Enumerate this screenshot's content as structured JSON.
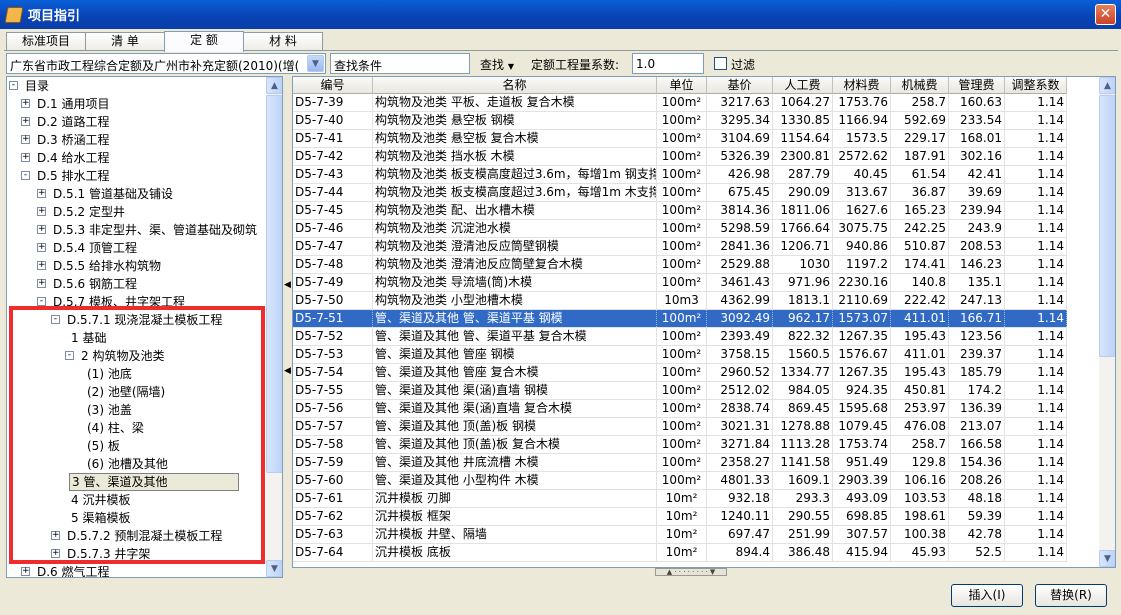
{
  "window": {
    "title": "项目指引"
  },
  "tabs": [
    "标准项目",
    "清 单",
    "定 额",
    "材 料"
  ],
  "toolbar": {
    "library": "广东省市政工程综合定额及广州市补充定额(2010)(增(",
    "search_value": "查找条件",
    "find_label": "查找",
    "coef_label": "定额工程量系数:",
    "coef_value": "1.0",
    "filter_label": "过滤"
  },
  "tree": [
    {
      "label": "目录",
      "pm": "-",
      "lvl": 0
    },
    {
      "label": "D.1  通用项目",
      "pm": "+",
      "lvl": 1
    },
    {
      "label": "D.2  道路工程",
      "pm": "+",
      "lvl": 1
    },
    {
      "label": "D.3  桥涵工程",
      "pm": "+",
      "lvl": 1
    },
    {
      "label": "D.4  给水工程",
      "pm": "+",
      "lvl": 1
    },
    {
      "label": "D.5  排水工程",
      "pm": "-",
      "lvl": 1
    },
    {
      "label": "D.5.1  管道基础及铺设",
      "pm": "+",
      "lvl": 2
    },
    {
      "label": "D.5.2  定型井",
      "pm": "+",
      "lvl": 2
    },
    {
      "label": "D.5.3  非定型井、渠、管道基础及砌筑",
      "pm": "+",
      "lvl": 2
    },
    {
      "label": "D.5.4  顶管工程",
      "pm": "+",
      "lvl": 2
    },
    {
      "label": "D.5.5  给排水构筑物",
      "pm": "+",
      "lvl": 2
    },
    {
      "label": "D.5.6  钢筋工程",
      "pm": "+",
      "lvl": 2
    },
    {
      "label": "D.5.7  模板、井字架工程",
      "pm": "-",
      "lvl": 2
    },
    {
      "label": "D.5.7.1  现浇混凝土模板工程",
      "pm": "-",
      "lvl": 3
    },
    {
      "label": "1  基础",
      "pm": "",
      "lvl": 4
    },
    {
      "label": "2  构筑物及池类",
      "pm": "-",
      "lvl": 4
    },
    {
      "label": "(1)  池底",
      "pm": "",
      "lvl": 5
    },
    {
      "label": "(2)  池壁(隔墙)",
      "pm": "",
      "lvl": 5
    },
    {
      "label": "(3)  池盖",
      "pm": "",
      "lvl": 5
    },
    {
      "label": "(4)  柱、梁",
      "pm": "",
      "lvl": 5
    },
    {
      "label": "(5)  板",
      "pm": "",
      "lvl": 5
    },
    {
      "label": "(6)  池槽及其他",
      "pm": "",
      "lvl": 5
    },
    {
      "label": "3  管、渠道及其他",
      "pm": "",
      "lvl": 4,
      "selected": true
    },
    {
      "label": "4  沉井模板",
      "pm": "",
      "lvl": 4
    },
    {
      "label": "5  渠箱模板",
      "pm": "",
      "lvl": 4
    },
    {
      "label": "D.5.7.2  预制混凝土模板工程",
      "pm": "+",
      "lvl": 3
    },
    {
      "label": "D.5.7.3  井字架",
      "pm": "+",
      "lvl": 3
    },
    {
      "label": "D.6  燃气工程",
      "pm": "+",
      "lvl": 1
    }
  ],
  "grid": {
    "columns": [
      "编号",
      "名称",
      "单位",
      "基价",
      "人工费",
      "材料费",
      "机械费",
      "管理费",
      "调整系数"
    ],
    "selected_index": 12,
    "rows": [
      [
        "D5-7-39",
        "构筑物及池类 平板、走道板 复合木模",
        "100m²",
        "3217.63",
        "1064.27",
        "1753.76",
        "258.7",
        "160.63",
        "1.14"
      ],
      [
        "D5-7-40",
        "构筑物及池类 悬空板 钢模",
        "100m²",
        "3295.34",
        "1330.85",
        "1166.94",
        "592.69",
        "233.54",
        "1.14"
      ],
      [
        "D5-7-41",
        "构筑物及池类 悬空板 复合木模",
        "100m²",
        "3104.69",
        "1154.64",
        "1573.5",
        "229.17",
        "168.01",
        "1.14"
      ],
      [
        "D5-7-42",
        "构筑物及池类 挡水板 木模",
        "100m²",
        "5326.39",
        "2300.81",
        "2572.62",
        "187.91",
        "302.16",
        "1.14"
      ],
      [
        "D5-7-43",
        "构筑物及池类 板支模高度超过3.6m，每增1m 钢支撑",
        "100m²",
        "426.98",
        "287.79",
        "40.45",
        "61.54",
        "42.41",
        "1.14"
      ],
      [
        "D5-7-44",
        "构筑物及池类 板支模高度超过3.6m，每增1m 木支撑",
        "100m²",
        "675.45",
        "290.09",
        "313.67",
        "36.87",
        "39.69",
        "1.14"
      ],
      [
        "D5-7-45",
        "构筑物及池类 配、出水槽木模",
        "100m²",
        "3814.36",
        "1811.06",
        "1627.6",
        "165.23",
        "239.94",
        "1.14"
      ],
      [
        "D5-7-46",
        "构筑物及池类 沉淀池水模",
        "100m²",
        "5298.59",
        "1766.64",
        "3075.75",
        "242.25",
        "243.9",
        "1.14"
      ],
      [
        "D5-7-47",
        "构筑物及池类 澄清池反应筒壁钢模",
        "100m²",
        "2841.36",
        "1206.71",
        "940.86",
        "510.87",
        "208.53",
        "1.14"
      ],
      [
        "D5-7-48",
        "构筑物及池类 澄清池反应筒壁复合木模",
        "100m²",
        "2529.88",
        "1030",
        "1197.2",
        "174.41",
        "146.23",
        "1.14"
      ],
      [
        "D5-7-49",
        "构筑物及池类 导流墙(筒)木模",
        "100m²",
        "3461.43",
        "971.96",
        "2230.16",
        "140.8",
        "135.1",
        "1.14"
      ],
      [
        "D5-7-50",
        "构筑物及池类 小型池槽木模",
        "10m3",
        "4362.99",
        "1813.1",
        "2110.69",
        "222.42",
        "247.13",
        "1.14"
      ],
      [
        "D5-7-51",
        "管、渠道及其他 管、渠道平基 钢模",
        "100m²",
        "3092.49",
        "962.17",
        "1573.07",
        "411.01",
        "166.71",
        "1.14"
      ],
      [
        "D5-7-52",
        "管、渠道及其他 管、渠道平基 复合木模",
        "100m²",
        "2393.49",
        "822.32",
        "1267.35",
        "195.43",
        "123.56",
        "1.14"
      ],
      [
        "D5-7-53",
        "管、渠道及其他 管座 钢模",
        "100m²",
        "3758.15",
        "1560.5",
        "1576.67",
        "411.01",
        "239.37",
        "1.14"
      ],
      [
        "D5-7-54",
        "管、渠道及其他 管座 复合木模",
        "100m²",
        "2960.52",
        "1334.77",
        "1267.35",
        "195.43",
        "185.79",
        "1.14"
      ],
      [
        "D5-7-55",
        "管、渠道及其他 渠(涵)直墙 钢模",
        "100m²",
        "2512.02",
        "984.05",
        "924.35",
        "450.81",
        "174.2",
        "1.14"
      ],
      [
        "D5-7-56",
        "管、渠道及其他 渠(涵)直墙 复合木模",
        "100m²",
        "2838.74",
        "869.45",
        "1595.68",
        "253.97",
        "136.39",
        "1.14"
      ],
      [
        "D5-7-57",
        "管、渠道及其他 顶(盖)板 钢模",
        "100m²",
        "3021.31",
        "1278.88",
        "1079.45",
        "476.08",
        "213.07",
        "1.14"
      ],
      [
        "D5-7-58",
        "管、渠道及其他 顶(盖)板 复合木模",
        "100m²",
        "3271.84",
        "1113.28",
        "1753.74",
        "258.7",
        "166.58",
        "1.14"
      ],
      [
        "D5-7-59",
        "管、渠道及其他 井底流槽 木模",
        "100m²",
        "2358.27",
        "1141.58",
        "951.49",
        "129.8",
        "154.36",
        "1.14"
      ],
      [
        "D5-7-60",
        "管、渠道及其他 小型构件 木模",
        "100m²",
        "4801.33",
        "1609.1",
        "2903.39",
        "106.16",
        "208.26",
        "1.14"
      ],
      [
        "D5-7-61",
        "沉井模板 刃脚",
        "10m²",
        "932.18",
        "293.3",
        "493.09",
        "103.53",
        "48.18",
        "1.14"
      ],
      [
        "D5-7-62",
        "沉井模板 框架",
        "10m²",
        "1240.11",
        "290.55",
        "698.85",
        "198.61",
        "59.39",
        "1.14"
      ],
      [
        "D5-7-63",
        "沉井模板 井壁、隔墙",
        "10m²",
        "697.47",
        "251.99",
        "307.57",
        "100.38",
        "42.78",
        "1.14"
      ],
      [
        "D5-7-64",
        "沉井模板 底板",
        "10m²",
        "894.4",
        "386.48",
        "415.94",
        "45.93",
        "52.5",
        "1.14"
      ]
    ]
  },
  "buttons": {
    "insert": "插入(I)",
    "replace": "替换(R)"
  },
  "colors": {
    "selection": "#316ac5",
    "highlight_box": "#ef2b2b",
    "titlebar": "#0842b3"
  }
}
